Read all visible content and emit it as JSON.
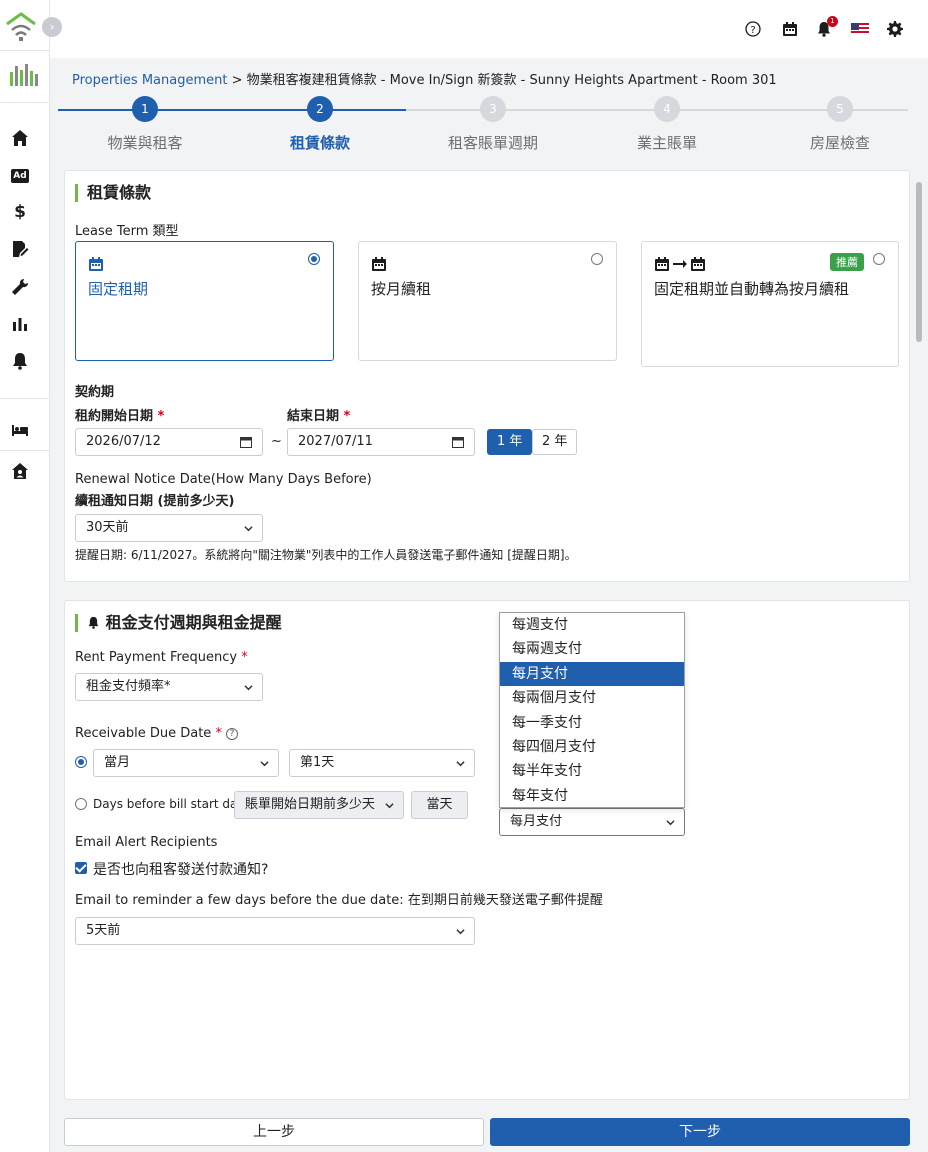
{
  "topbar": {
    "help_icon": "help-circle-icon",
    "calendar_icon": "calendar-icon",
    "notifications_icon": "bell-icon",
    "notification_count": "1",
    "language_flag": "us-flag-icon",
    "settings_icon": "gear-icon"
  },
  "breadcrumb": {
    "link": "Properties Management",
    "separator": ">",
    "current": "物業租客複建租賃條款 - Move In/Sign 新簽款 - Sunny Heights Apartment - Room 301"
  },
  "stepper": {
    "steps": [
      {
        "number": "1",
        "label": "物業與租客"
      },
      {
        "number": "2",
        "label": "租賃條款"
      },
      {
        "number": "3",
        "label": "租客賬單週期"
      },
      {
        "number": "4",
        "label": "業主賬單"
      },
      {
        "number": "5",
        "label": "房屋檢查"
      }
    ],
    "active_step": 2
  },
  "lease_card": {
    "title": "租賃條款",
    "lease_term_label": "Lease Term 類型",
    "options": [
      {
        "label": "固定租期",
        "selected": true
      },
      {
        "label": "按月續租",
        "selected": false
      },
      {
        "label": "固定租期並自動轉為按月續租",
        "selected": false,
        "badge": "推薦"
      }
    ],
    "contract_period_label": "契約期",
    "start_label": "租約開始日期",
    "end_label": "結束日期",
    "required_mark": "*",
    "start_date": "2026/07/12",
    "tilde": "~",
    "end_date": "2027/07/11",
    "year_buttons": [
      "1 年",
      "2 年"
    ],
    "renewal_label_en": "Renewal Notice Date(How Many Days Before)",
    "renewal_label_zh": "續租通知日期 (提前多少天)",
    "renewal_value": "30天前",
    "reminder_note": "提醒日期: 6/11/2027。系統將向\"關注物業\"列表中的工作人員發送電子郵件通知 [提醒日期]。"
  },
  "rent_card": {
    "title": "租金支付週期與租金提醒",
    "frequency_label": "Rent Payment Frequency",
    "required_mark": "*",
    "frequency_placeholder": "租金支付頻率*",
    "due_date_label": "Receivable Due Date",
    "due_month": "當月",
    "due_day": "第1天",
    "days_before_label": "Days before bill start date:",
    "days_before_select": "賬單開始日期前多少天",
    "days_before_btn": "當天",
    "email_recipients_label": "Email Alert Recipients",
    "notify_tenant_label": "是否也向租客發送付款通知?",
    "reminder_label": "Email to reminder a few days before the due date: 在到期日前幾天發送電子郵件提醒",
    "reminder_value": "5天前"
  },
  "frequency_dropdown": {
    "options": [
      "每週支付",
      "每兩週支付",
      "每月支付",
      "每兩個月支付",
      "每一季支付",
      "每四個月支付",
      "每半年支付",
      "每年支付"
    ],
    "selected": "每月支付"
  },
  "footer": {
    "prev_label": "上一步",
    "next_label": "下一步"
  },
  "colors": {
    "primary": "#1f5fad",
    "accent_green": "#6cbd45",
    "badge_green": "#3aa04a",
    "required": "#d0021b"
  }
}
